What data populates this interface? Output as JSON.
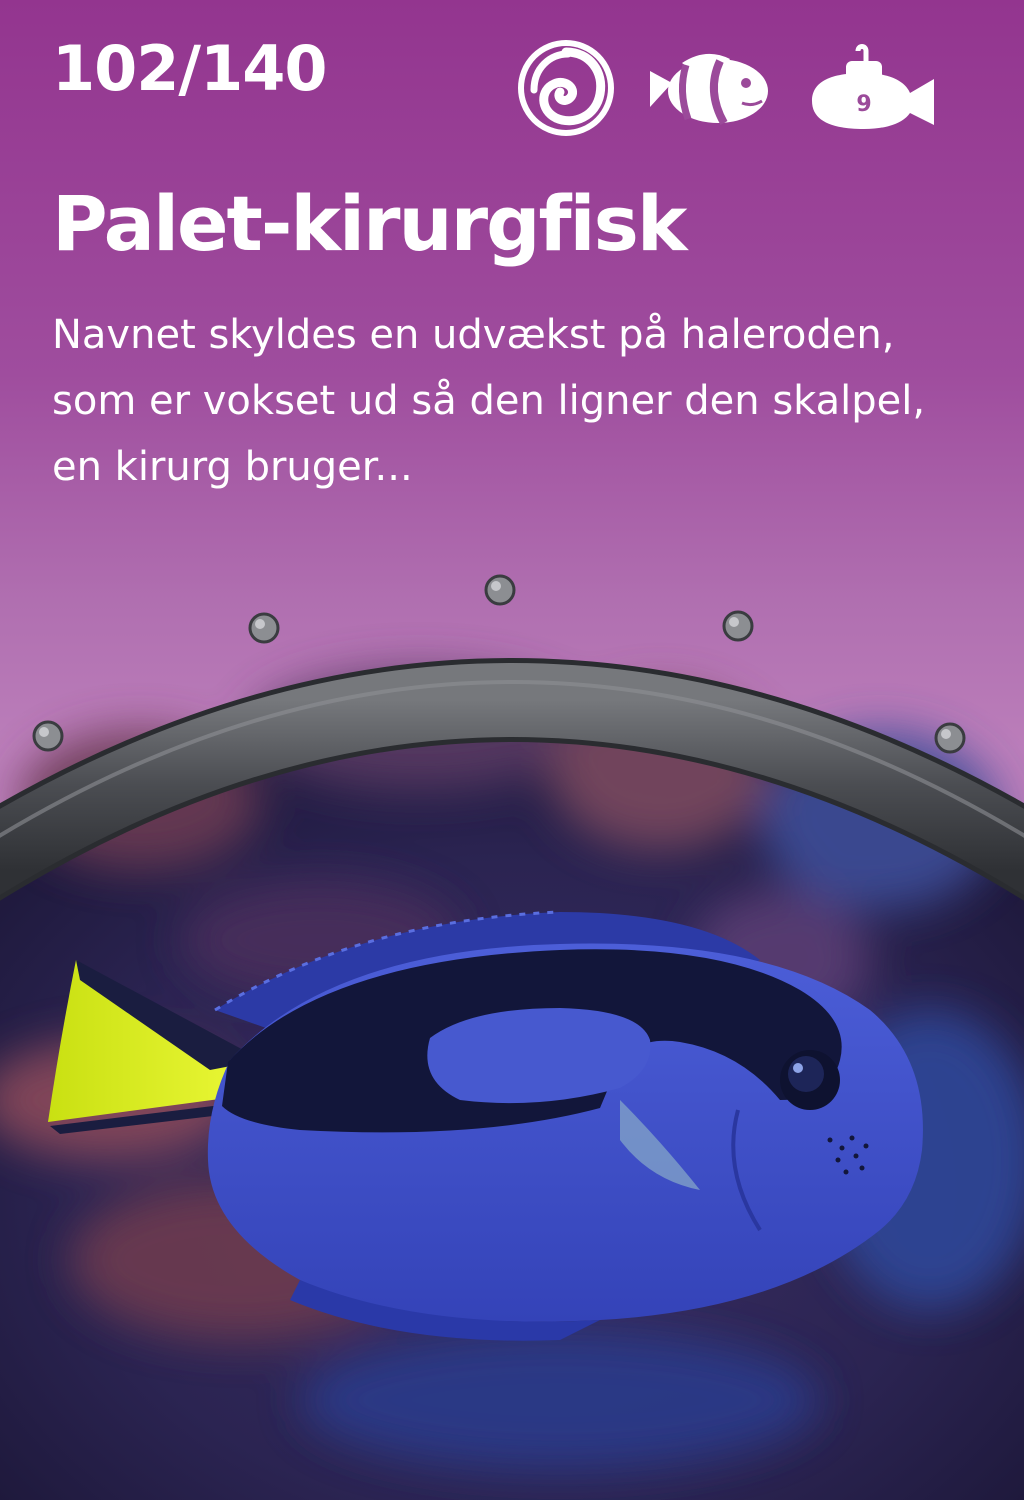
{
  "card": {
    "counter": "102/140",
    "title": "Palet-kirurgfisk",
    "description": "Navnet skyldes en udvækst på haleroden, som er vokset ud så den ligner den skalpel, en kirurg bruger...",
    "icons": [
      {
        "name": "swirl-emblem-icon"
      },
      {
        "name": "clownfish-icon"
      },
      {
        "name": "submarine-icon",
        "label": "9"
      }
    ],
    "colors": {
      "background_top": "#93358f",
      "background_mid": "#bb7eba",
      "fish_blue": "#3e4fc9",
      "fish_tail": "#d9ef1c"
    }
  }
}
